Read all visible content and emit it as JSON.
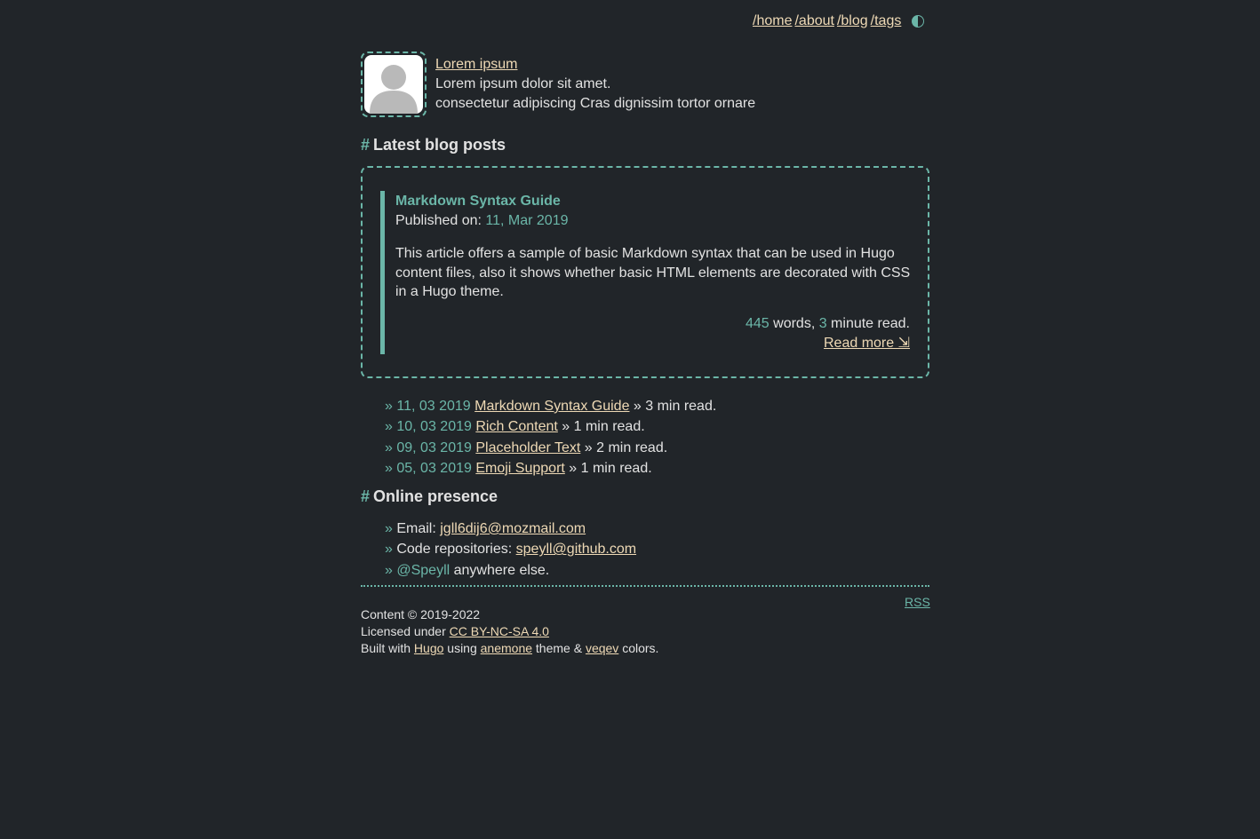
{
  "nav": {
    "items": [
      "/home",
      "/about",
      "/blog",
      "/tags"
    ],
    "theme_toggle_icon": "half-circle-icon"
  },
  "profile": {
    "name": "Lorem ipsum",
    "line1": "Lorem ipsum dolor sit amet.",
    "line2": "consectetur adipiscing Cras dignissim tortor ornare",
    "avatar_icon": "user-avatar-icon"
  },
  "latest": {
    "hash": "#",
    "heading": "Latest blog posts"
  },
  "featured": {
    "title": "Markdown Syntax Guide",
    "published_label": "Published on: ",
    "published_date": "11, Mar 2019",
    "summary": "This article offers a sample of basic Markdown syntax that can be used in Hugo content files, also it shows whether basic HTML elements are decorated with CSS in a Hugo theme.",
    "words": "445",
    "words_label": " words, ",
    "minutes": "3",
    "minutes_label": " minute read.",
    "read_more": "Read more ⇲"
  },
  "posts": [
    {
      "raquo": "»",
      "date": "11, 03 2019",
      "title": "Markdown Syntax Guide",
      "suffix": " » 3 min read."
    },
    {
      "raquo": "»",
      "date": "10, 03 2019",
      "title": "Rich Content",
      "suffix": " » 1 min read."
    },
    {
      "raquo": "»",
      "date": "09, 03 2019",
      "title": "Placeholder Text",
      "suffix": " » 2 min read."
    },
    {
      "raquo": "»",
      "date": "05, 03 2019",
      "title": "Emoji Support",
      "suffix": " » 1 min read."
    }
  ],
  "presence": {
    "hash": "#",
    "heading": "Online presence",
    "items": [
      {
        "raquo": "»",
        "label": " Email: ",
        "link": "jgll6dij6@mozmail.com"
      },
      {
        "raquo": "»",
        "label": " Code repositories: ",
        "link": "speyll@github.com"
      },
      {
        "raquo": "»",
        "handle": "@Speyll",
        "label": " anywhere else."
      }
    ]
  },
  "footer": {
    "rss": "RSS",
    "content_line": "Content © 2019-2022",
    "licensed_label": "Licensed under ",
    "license": "CC BY-NC-SA 4.0",
    "built_label": "Built with ",
    "hugo": "Hugo",
    "using_label": " using ",
    "theme": "anemone",
    "theme_label": " theme & ",
    "colors": "veqev",
    "colors_label": " colors."
  },
  "colors": {
    "background": "#212529",
    "accent": "#6bb6a8",
    "link": "#eed9b5",
    "text": "#e2e2e2"
  }
}
